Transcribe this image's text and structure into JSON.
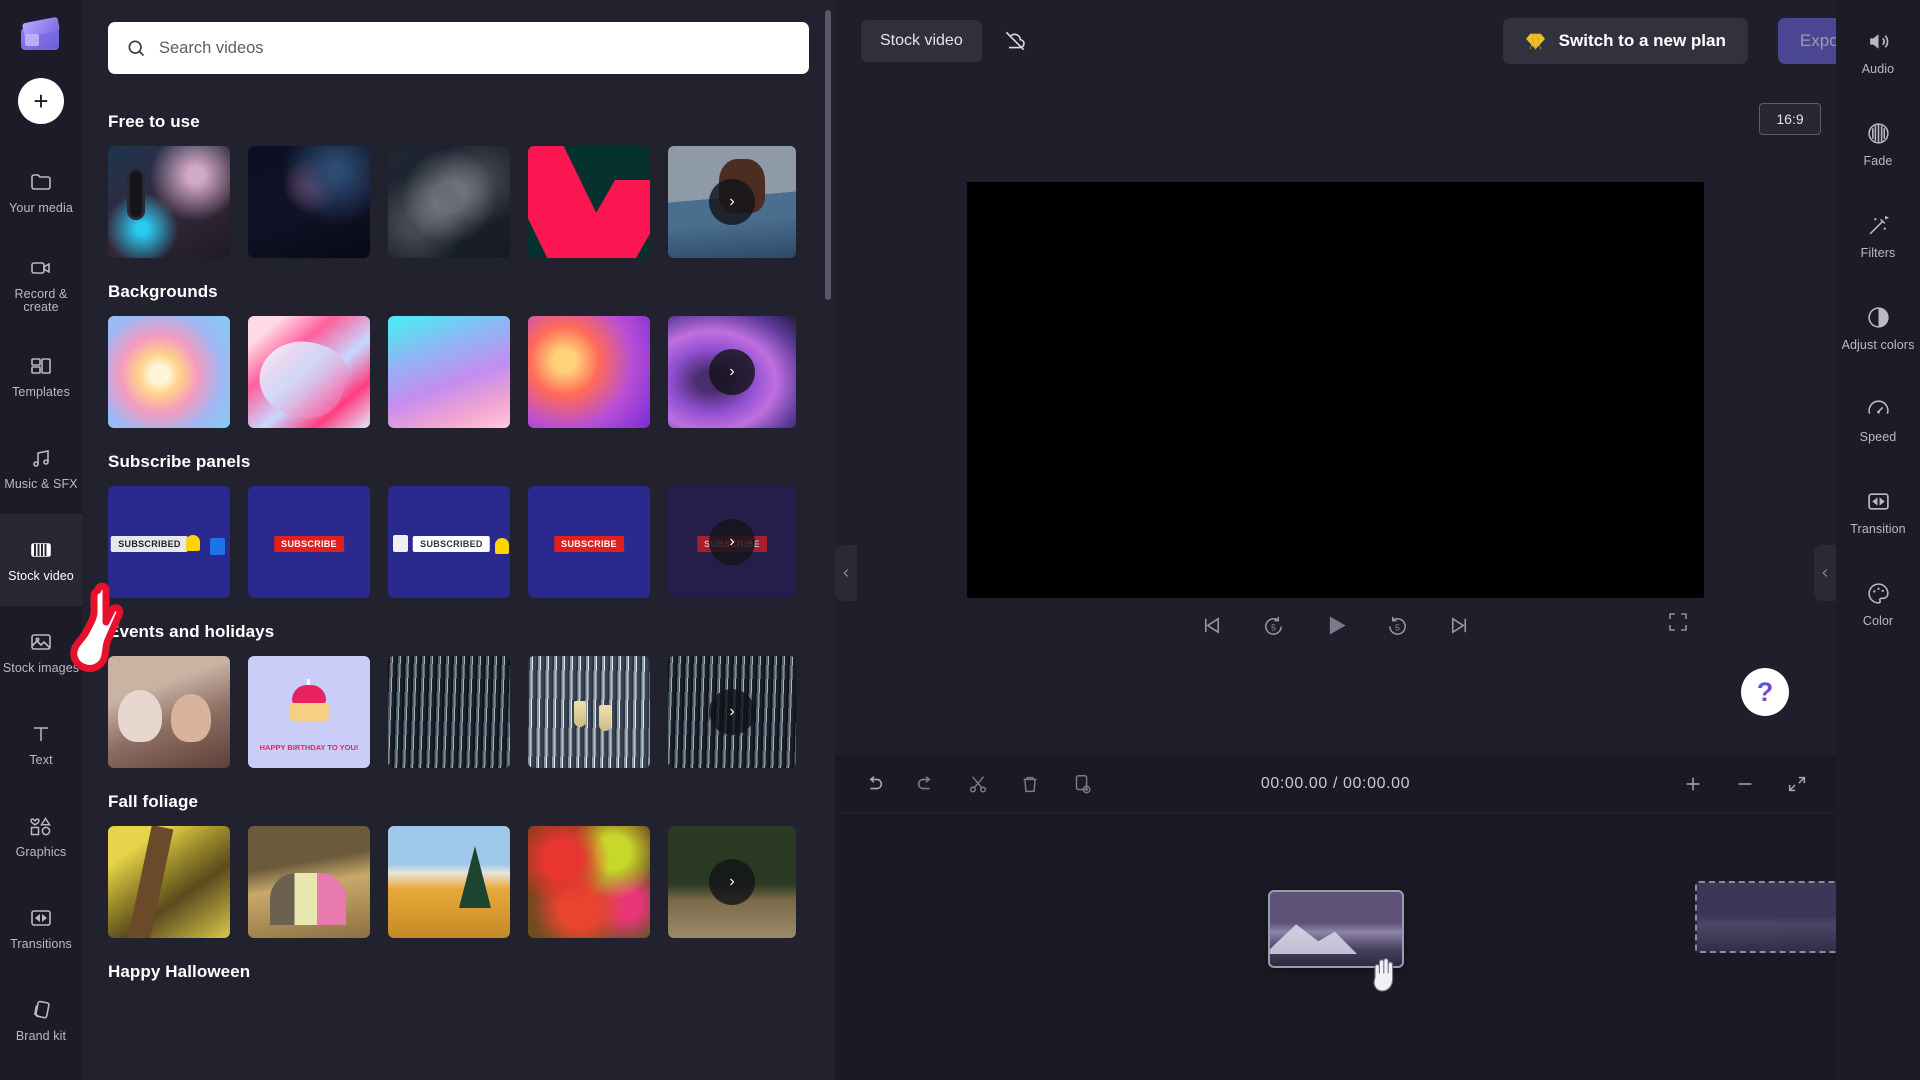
{
  "app": {
    "logo_name": "clipchamp-logo"
  },
  "sidebar": {
    "add_button_label": "+",
    "items": [
      {
        "label": "Your media",
        "icon": "folder-icon",
        "active": false
      },
      {
        "label": "Record & create",
        "icon": "video-camera-icon",
        "active": false
      },
      {
        "label": "Templates",
        "icon": "templates-grid-icon",
        "active": false
      },
      {
        "label": "Music & SFX",
        "icon": "music-note-icon",
        "active": false
      },
      {
        "label": "Stock video",
        "icon": "film-strip-icon",
        "active": true
      },
      {
        "label": "Stock images",
        "icon": "image-icon",
        "active": false
      },
      {
        "label": "Text",
        "icon": "text-t-icon",
        "active": false
      },
      {
        "label": "Graphics",
        "icon": "shapes-icon",
        "active": false
      },
      {
        "label": "Transitions",
        "icon": "transition-icon",
        "active": false
      },
      {
        "label": "Brand kit",
        "icon": "brand-kit-icon",
        "active": false
      }
    ]
  },
  "search": {
    "placeholder": "Search videos",
    "value": "",
    "icon": "search-icon"
  },
  "library": {
    "sections": [
      {
        "title": "Free to use",
        "thumbs": [
          {
            "name": "podcast-microphone-clip",
            "art": "a-mic"
          },
          {
            "name": "dark-bokeh-clip",
            "art": "a-dark"
          },
          {
            "name": "grunge-texture-clip",
            "art": "a-grunge"
          },
          {
            "name": "pink-arrow-graphic-clip",
            "art": "a-arrow"
          },
          {
            "name": "swimmer-clip",
            "art": "a-swim"
          }
        ],
        "more_label": "›"
      },
      {
        "title": "Backgrounds",
        "thumbs": [
          {
            "name": "pastel-swirl-background",
            "art": "bg1"
          },
          {
            "name": "pink-ribbon-background",
            "art": "bg2"
          },
          {
            "name": "cyan-purple-gradient-background",
            "art": "bg3"
          },
          {
            "name": "orange-purple-gradient-background",
            "art": "bg4"
          },
          {
            "name": "violet-wave-background",
            "art": "bg5"
          }
        ],
        "more_label": "›"
      },
      {
        "title": "Subscribe panels",
        "thumbs": [
          {
            "name": "subscribed-bell-panel",
            "art": "sub",
            "badge": "SUBSCRIBED",
            "badge_style": "grey"
          },
          {
            "name": "subscribe-glitch-panel",
            "art": "sub",
            "badge": "SUBSCRIBE",
            "badge_style": "red"
          },
          {
            "name": "subscribed-hand-panel",
            "art": "sub",
            "badge": "SUBSCRIBED",
            "badge_style": "white"
          },
          {
            "name": "subscribe-button-panel",
            "art": "sub",
            "badge": "SUBSCRIBE",
            "badge_style": "red"
          },
          {
            "name": "subscribe-dark-panel",
            "art": "sub",
            "badge": "SUBSCRIBE",
            "badge_style": "red"
          }
        ],
        "more_label": "›"
      },
      {
        "title": "Events and holidays",
        "thumbs": [
          {
            "name": "party-hats-family-clip",
            "art": "ev1"
          },
          {
            "name": "happy-birthday-cupcake-clip",
            "art": "ev2",
            "caption": "HAPPY BIRTHDAY TO YOU!"
          },
          {
            "name": "silver-tinsel-clip",
            "art": "tinsel"
          },
          {
            "name": "champagne-toast-clip",
            "art": "tinsel bright"
          },
          {
            "name": "dark-tinsel-clip",
            "art": "tinsel"
          }
        ],
        "more_label": "›"
      },
      {
        "title": "Fall foliage",
        "thumbs": [
          {
            "name": "yellow-leaves-branch-clip",
            "art": "fa1"
          },
          {
            "name": "family-in-autumn-woods-clip",
            "art": "fa2"
          },
          {
            "name": "autumn-mountain-pine-clip",
            "art": "fa3"
          },
          {
            "name": "red-yellow-maple-clip",
            "art": "fa4"
          },
          {
            "name": "forest-leaf-ground-clip",
            "art": "fa5"
          }
        ],
        "more_label": "›"
      },
      {
        "title": "Happy Halloween",
        "thumbs": [],
        "more_label": "›"
      }
    ]
  },
  "header": {
    "active_tab": "Stock video",
    "cloud_icon": "cloud-off-icon",
    "plan_button": "Switch to a new plan",
    "plan_icon": "gem-icon",
    "export_button": "Export",
    "export_chevron": "chevron-down-icon"
  },
  "preview": {
    "aspect_ratio": "16:9",
    "help_label": "?",
    "controls": {
      "skip_start": "skip-to-start-icon",
      "back5": "rewind-5-icon",
      "play": "play-icon",
      "forward5": "forward-5-icon",
      "skip_end": "skip-to-end-icon",
      "fullscreen": "fullscreen-icon"
    }
  },
  "timeline": {
    "toolbar": {
      "undo": "undo-icon",
      "redo": "redo-icon",
      "split": "scissors-icon",
      "delete": "trash-icon",
      "duplicate": "duplicate-icon",
      "zoom_in": "plus-icon",
      "zoom_out": "minus-icon",
      "fit": "fit-to-screen-icon"
    },
    "time_current": "00:00.00",
    "time_total": "00:00.00",
    "time_display": "00:00.00 / 00:00.00",
    "drag_clip_name": "mountain-sunset-clip",
    "drop_zone_name": "timeline-drop-target"
  },
  "tools": {
    "items": [
      {
        "label": "Audio",
        "icon": "speaker-icon"
      },
      {
        "label": "Fade",
        "icon": "fade-circle-icon"
      },
      {
        "label": "Filters",
        "icon": "magic-wand-icon"
      },
      {
        "label": "Adjust colors",
        "icon": "contrast-circle-icon"
      },
      {
        "label": "Speed",
        "icon": "speedometer-icon"
      },
      {
        "label": "Transition",
        "icon": "transition-icon"
      },
      {
        "label": "Color",
        "icon": "palette-icon"
      }
    ]
  },
  "colors": {
    "app_bg": "#1f1f2b",
    "rail_bg": "#1c1c28",
    "panel_bg": "#22222e",
    "timeline_bg": "#1a1a24",
    "accent_purple": "#4b4691",
    "gem_yellow": "#f2c12e",
    "subscribe_red": "#e02020"
  }
}
